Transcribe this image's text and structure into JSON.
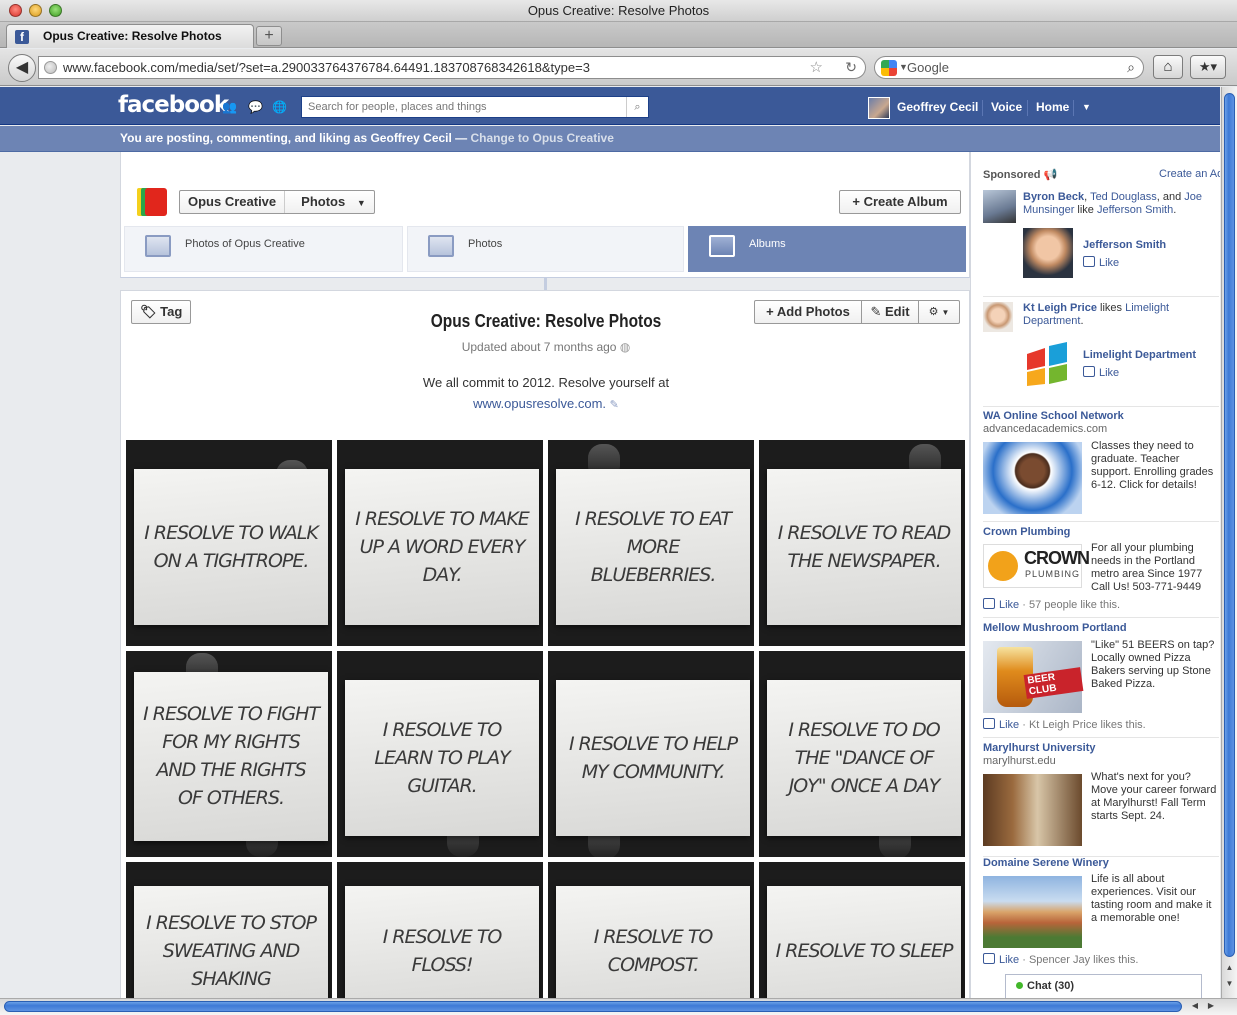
{
  "window": {
    "title": "Opus Creative: Resolve Photos"
  },
  "tab": {
    "label": "Opus Creative: Resolve Photos",
    "favicon": "f",
    "new_tab": "+",
    "close": "✕"
  },
  "nav": {
    "url": "www.facebook.com/media/set/?set=a.290033764376784.64491.183708768342618&type=3",
    "search_engine": "Google"
  },
  "fb_header": {
    "logo": "facebook",
    "search_placeholder": "Search for people, places and things",
    "user_name": "Geoffrey Cecil",
    "voice": "Voice",
    "home": "Home"
  },
  "posting_bar": {
    "text": "You are posting, commenting, and liking as Geoffrey Cecil — ",
    "change_link": "Change to Opus Creative"
  },
  "page_header": {
    "page_name": "Opus Creative",
    "section": "Photos",
    "create_album": "+ Create Album",
    "subtabs": [
      {
        "label": "Photos of Opus Creative"
      },
      {
        "label": "Photos"
      },
      {
        "label": "Albums"
      }
    ]
  },
  "album": {
    "tag": "Tag",
    "title": "Opus Creative: Resolve Photos",
    "updated": "Updated about 7 months ago",
    "description": "We all commit to 2012. Resolve yourself at",
    "link": "www.opusresolve.com.",
    "add_photos": "+ Add Photos",
    "edit": "Edit",
    "photos": [
      {
        "caption": "I resolve to walk on a tightrope."
      },
      {
        "caption": "I resolve to make up a word every day."
      },
      {
        "caption": "I resolve to eat more blueberries."
      },
      {
        "caption": "I resolve to read the newspaper."
      },
      {
        "caption": "I resolve to fight for my rights and the rights of others."
      },
      {
        "caption": "I resolve to learn to play guitar."
      },
      {
        "caption": "I resolve to help my community."
      },
      {
        "caption": "I resolve to do the \"dance of joy\" once a day"
      },
      {
        "caption": "I resolve to stop sweating and shaking"
      },
      {
        "caption": "I resolve to floss!"
      },
      {
        "caption": "I resolve to compost."
      },
      {
        "caption": "I resolve to sleep"
      }
    ]
  },
  "sidebar": {
    "sponsored": "Sponsored",
    "create_ad": "Create an Ad",
    "social1": {
      "names": "Byron Beck",
      "sep1": ", ",
      "name2": "Ted Douglass",
      "and": ", and",
      "name3": "Joe Munsinger",
      "like_text": " like ",
      "target": "Jefferson Smith",
      "end": ".",
      "page": "Jefferson Smith",
      "like": "Like"
    },
    "social2": {
      "name": "Kt Leigh Price",
      "likes": " likes ",
      "target": "Limelight Department",
      "end": ".",
      "page": "Limelight Department",
      "like": "Like"
    },
    "ads": [
      {
        "title": "WA Online School Network",
        "domain": "advancedacademics.com",
        "body": "Classes they need to graduate. Teacher support. Enrolling grades 6-12. Click for details!"
      },
      {
        "title": "Crown Plumbing",
        "body": "For all your plumbing needs in the Portland metro area Since 1977 Call Us! 503-771-9449",
        "like": "Like",
        "social": " · 57 people like this.",
        "logo_text": "CROWN",
        "logo_sub": "PLUMBING"
      },
      {
        "title": "Mellow Mushroom Portland",
        "body": "\"Like\" 51 BEERS on tap? Locally owned Pizza Bakers serving up Stone Baked Pizza.",
        "like": "Like",
        "social": " · Kt Leigh Price likes this.",
        "badge": "BEER CLUB"
      },
      {
        "title": "Marylhurst University",
        "domain": "marylhurst.edu",
        "body": "What's next for you? Move your career forward at Marylhurst! Fall Term starts Sept. 24."
      },
      {
        "title": "Domaine Serene Winery",
        "body": "Life is all about experiences. Visit our tasting room and make it a memorable one!",
        "like": "Like",
        "social": " · Spencer Jay likes this."
      }
    ],
    "chat": "Chat (30)"
  },
  "colors": {
    "fb_blue": "#3b5998",
    "posting_bar": "#6d84b4",
    "link": "#3b5998"
  }
}
